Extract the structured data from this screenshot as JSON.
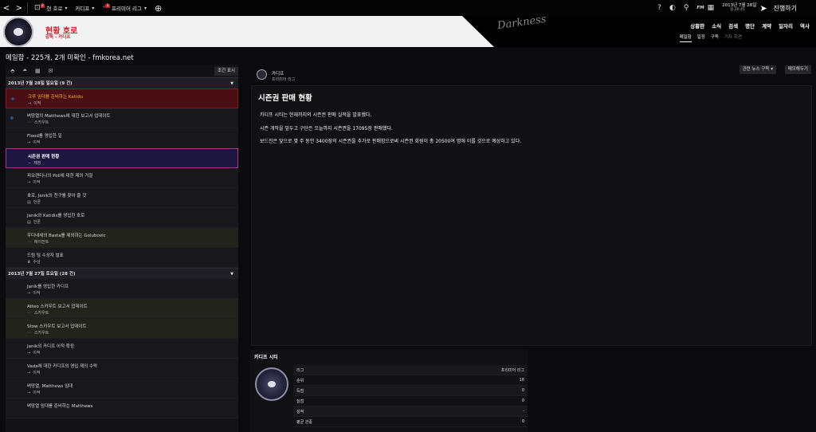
{
  "topbar": {
    "back": "<",
    "forward": ">",
    "menu1": {
      "badge": "2",
      "label": "현 호로"
    },
    "menu2": {
      "label": "카디프"
    },
    "menu3": {
      "badge": "1",
      "label": "프리미어 리그"
    },
    "fm_label": "FM",
    "date": "2013년 7월 28일",
    "time": "일 20:45",
    "continue": "진행하기"
  },
  "header": {
    "title": "현황 호로",
    "subtitle": "감독 - 카디프",
    "watermark": "Darkness",
    "nav": [
      "상황판",
      "소식",
      "검색",
      "명단",
      "계약",
      "일자리",
      "역사"
    ],
    "subnav": [
      "메일함",
      "일정",
      "구독",
      "기자 회견"
    ]
  },
  "page_title": "메일함 - 225개, 2개 미확인 - fmkorea.net",
  "left": {
    "filter_button": "조건 표시",
    "groups": [
      {
        "header": "2013년 7월 28일 일요일 (9 건)",
        "items": [
          {
            "subject": "크루 임대를 준비하는 Katidis",
            "category": "이적",
            "icon": "→",
            "style": "red"
          },
          {
            "subject": "벼망열의 Matthews에 대한 보고서 업데이트",
            "category": "스카우트",
            "icon": "◦◦",
            "style": "unread"
          },
          {
            "subject": "Flood를 영입한 일",
            "category": "이적",
            "icon": "→",
            "style": ""
          },
          {
            "subject": "시즌권 판매 현황",
            "category": "재정",
            "icon": "∼",
            "style": "sel"
          },
          {
            "subject": "피오렌티나의 Poli에 대한 제의 거절",
            "category": "이적",
            "icon": "→",
            "style": ""
          },
          {
            "subject": "호로, Janik의 친구를 찾아 줄 것",
            "category": "언론",
            "icon": "▤",
            "style": ""
          },
          {
            "subject": "Janik와 Katidis를 영입한 호로",
            "category": "언론",
            "icon": "▤",
            "style": ""
          },
          {
            "subject": "우디네세의 Basta를 제외하는 Golubovic",
            "category": "에이전트",
            "icon": "◦◦",
            "style": "olive"
          },
          {
            "subject": "드림 팀 수상자 발표",
            "category": "수상",
            "icon": "♛",
            "style": ""
          }
        ]
      },
      {
        "header": "2013년 7월 27일 토요일 (28 건)",
        "items": [
          {
            "subject": "Janik를 영입한 카디프",
            "category": "이적",
            "icon": "→",
            "style": ""
          },
          {
            "subject": "Atteo 스카우트 보고서 업데이트",
            "category": "스카우트",
            "icon": "◦◦",
            "style": "olive"
          },
          {
            "subject": "Stow 스카우트 보고서 업데이트",
            "category": "스카우트",
            "icon": "◦◦",
            "style": "olive"
          },
          {
            "subject": "Janik의 카디프 이적 확정",
            "category": "이적",
            "icon": "→",
            "style": ""
          },
          {
            "subject": "Vada에 대한 카디프의 영입 제의 수락",
            "category": "이적",
            "icon": "→",
            "style": ""
          },
          {
            "subject": "벼망열, Matthews 임대",
            "category": "이적",
            "icon": "→",
            "style": ""
          },
          {
            "subject": "벼망열 임대를 준비하는 Matthews",
            "category": "",
            "icon": "",
            "style": ""
          }
        ]
      }
    ]
  },
  "right": {
    "from_name": "카디프",
    "from_league": "프리미어 리그",
    "subscribe_button": "관련 뉴스 구독",
    "memo_button": "메모해두기",
    "article": {
      "title": "시즌권 판매 현황",
      "paragraphs": [
        "카디프 시티는 현재까지의 시즌권 판매 실적을 발표했다.",
        "시즌 개막을 앞두고 구단은 오늘까지 시즌권을 17095장 판매했다.",
        "보드진은 앞으로 몇 주 동안 3400장의 시즌권을 추가로 판매함으로써 시즌권 회원이 총 20500여 명에 이를 것으로 예상하고 있다."
      ]
    },
    "club": {
      "title": "카디프 시티",
      "rows": [
        {
          "k": "리그",
          "v": "프리미어 리그"
        },
        {
          "k": "순위",
          "v": "18"
        },
        {
          "k": "득점",
          "v": "0"
        },
        {
          "k": "실점",
          "v": "0"
        },
        {
          "k": "성적",
          "v": "-"
        },
        {
          "k": "평균 관중",
          "v": "0"
        }
      ]
    }
  }
}
